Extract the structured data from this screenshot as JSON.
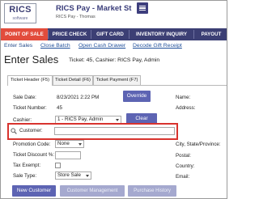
{
  "app": {
    "logo": "RICS",
    "logo_sub": "software",
    "title": "RICS Pay - Market St",
    "subtitle": "RICS Pay - Thomas"
  },
  "icons": [
    "menu-icon",
    "search-icon",
    "dropdown-caret-icon"
  ],
  "colors": {
    "nav": "#3c3f74",
    "nav_active": "#e24c3c",
    "button": "#5d64b3",
    "button_disabled": "#a5a9cf",
    "highlight": "#d8332e",
    "link": "#1f4f9a"
  },
  "nav": {
    "items": [
      {
        "label": "POINT OF SALE",
        "active": true
      },
      {
        "label": "PRICE CHECK",
        "active": false
      },
      {
        "label": "GIFT CARD",
        "active": false
      },
      {
        "label": "INVENTORY INQUIRY",
        "active": false
      },
      {
        "label": "PAYOUT",
        "active": false
      }
    ]
  },
  "subnav": {
    "links": [
      "Enter Sales",
      "Close Batch",
      "Open Cash Drawer",
      "Decode Gift Receipt"
    ]
  },
  "page": {
    "title": "Enter Sales",
    "ticket_info": "Ticket: 45, Cashier: RICS Pay, Admin"
  },
  "tabs": [
    "Ticket Header (F5)",
    "Ticket Detail (F6)",
    "Ticket Payment (F7)"
  ],
  "form": {
    "sale_date_label": "Sale Date:",
    "sale_date_value": "8/23/2021 2:22 PM",
    "override_label": "Override",
    "ticket_number_label": "Ticket Number:",
    "ticket_number_value": "45",
    "cashier_label": "Cashier:",
    "cashier_value": "1 - RICS Pay, Admin",
    "clear_label": "Clear",
    "customer_label": "Customer:",
    "customer_value": "",
    "promotion_code_label": "Promotion Code:",
    "promotion_code_value": "None",
    "ticket_discount_label": "Ticket Discount %:",
    "ticket_discount_value": "",
    "tax_exempt_label": "Tax Exempt:",
    "tax_exempt_checked": false,
    "sale_type_label": "Sale Type:",
    "sale_type_value": "Store Sale",
    "name_label": "Name:",
    "address_label": "Address:",
    "city_label": "City, State/Province:",
    "postal_label": "Postal:",
    "country_label": "Country:",
    "email_label": "Email:"
  },
  "actions": {
    "new_customer": "New Customer",
    "customer_management": "Customer Management",
    "purchase_history": "Purchase History"
  }
}
